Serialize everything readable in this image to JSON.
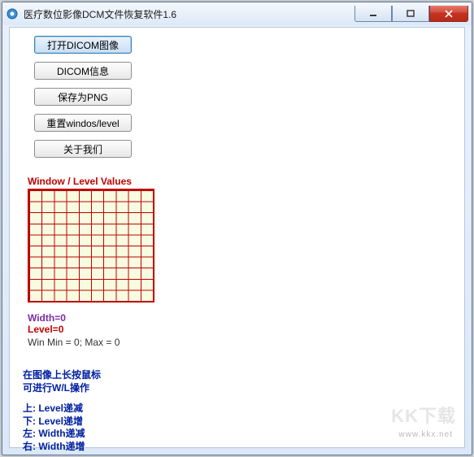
{
  "window": {
    "title": "医疗数位影像DCM文件恢复软件1.6"
  },
  "buttons": {
    "open": "打开DICOM图像",
    "info": "DICOM信息",
    "savepng": "保存为PNG",
    "reset": "重置windos/level",
    "about": "关于我们"
  },
  "wl": {
    "heading": "Window / Level Values",
    "width": "Width=0",
    "level": "Level=0",
    "minmax": "Win Min = 0; Max = 0"
  },
  "instructions": {
    "l1": "在图像上长按鼠标",
    "l2": "可进行W/L操作",
    "up": "上: Level递减",
    "down": "下: Level递增",
    "left": "左: Width递减",
    "right": "右: Width递增"
  },
  "watermark": {
    "big": "KK下载",
    "small": "www.kkx.net"
  }
}
